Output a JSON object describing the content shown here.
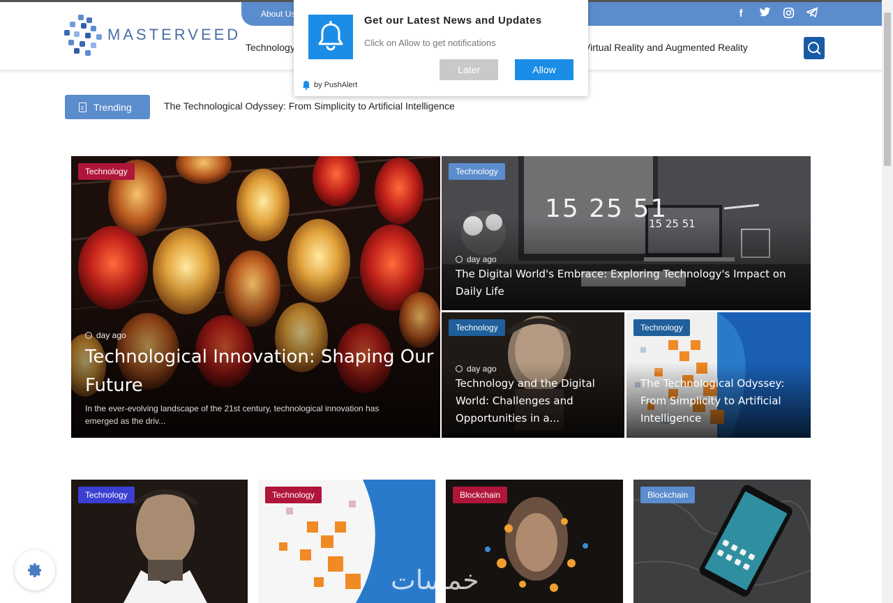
{
  "brand": {
    "name": "MASTERVEED"
  },
  "topbar": {
    "link": "About Us",
    "social": [
      {
        "icon": "facebook-icon",
        "glyph": "f"
      },
      {
        "icon": "twitter-icon",
        "glyph": "t"
      },
      {
        "icon": "instagram-icon",
        "glyph": "◎"
      },
      {
        "icon": "telegram-icon",
        "glyph": "➤"
      }
    ]
  },
  "nav": {
    "items": [
      "Technology",
      "Virtual Reality and Augmented Reality"
    ]
  },
  "trending": {
    "label": "Trending",
    "headline": "The Technological Odyssey: From Simplicity to Artificial Intelligence"
  },
  "hero": {
    "main": {
      "category": "Technology",
      "time": "day ago",
      "title": "Technological Innovation: Shaping Our Future",
      "excerpt": "In the ever-evolving landscape of the 21st century, technological innovation has emerged as the driv..."
    },
    "top_right": {
      "category": "Technology",
      "time": "day ago",
      "title": "The Digital World's Embrace: Exploring Technology's Impact on Daily Life",
      "clock_big": "15 25 51",
      "clock_small": "15 25 51"
    },
    "bottom_left": {
      "category": "Technology",
      "time": "day ago",
      "title": "Technology and the Digital World: Challenges and Opportunities in a..."
    },
    "bottom_right": {
      "category": "Technology",
      "time": "day ago",
      "title": "The Technological Odyssey: From Simplicity to Artificial Intelligence"
    }
  },
  "grid": [
    {
      "category": "Technology",
      "color": "#3b3fd0"
    },
    {
      "category": "Technology",
      "color": "#b0163a"
    },
    {
      "category": "Blockchain",
      "color": "#b0163a"
    },
    {
      "category": "Blockchain",
      "color": "#5b8ccd"
    }
  ],
  "popup": {
    "title": "Get our Latest News and Updates",
    "subtitle": "Click on Allow to get notifications",
    "later": "Later",
    "allow": "Allow",
    "by": "by PushAlert"
  },
  "watermark": "خمسات",
  "colors": {
    "accent": "#5b8ccd",
    "badge_red": "#b0163a",
    "badge_blue": "#1f5f9a",
    "badge_light": "#5b8ccd",
    "allow": "#1b8de6"
  }
}
